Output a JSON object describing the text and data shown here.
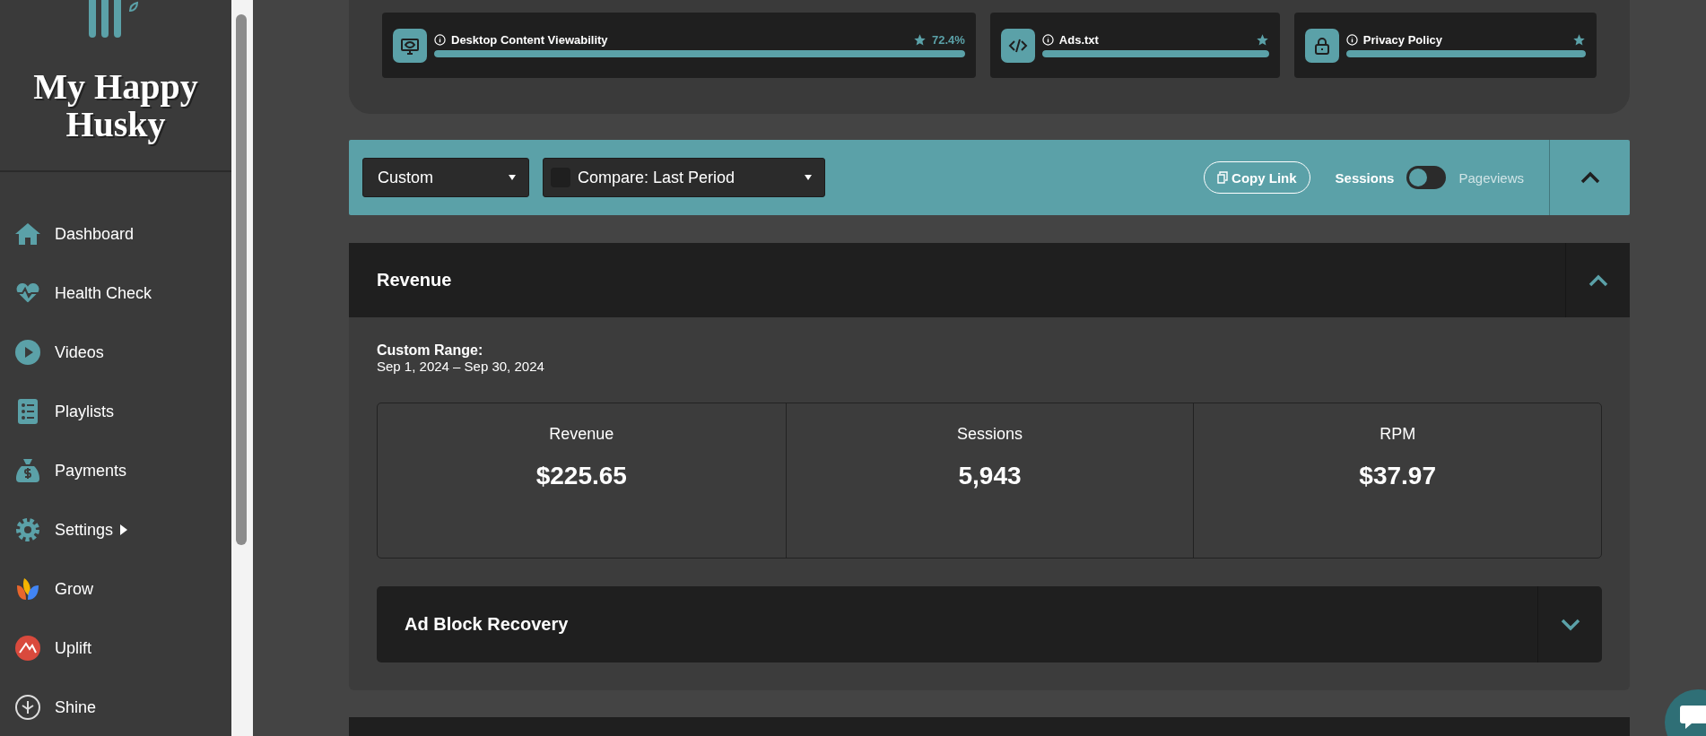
{
  "sidebar": {
    "brand": "My Happy Husky",
    "items": [
      {
        "label": "Dashboard",
        "submenu": false
      },
      {
        "label": "Health Check",
        "submenu": false
      },
      {
        "label": "Videos",
        "submenu": false
      },
      {
        "label": "Playlists",
        "submenu": false
      },
      {
        "label": "Payments",
        "submenu": false
      },
      {
        "label": "Settings",
        "submenu": true
      },
      {
        "label": "Grow",
        "submenu": false
      },
      {
        "label": "Uplift",
        "submenu": false
      },
      {
        "label": "Shine",
        "submenu": false
      }
    ]
  },
  "health_cards": [
    {
      "title": "Desktop Content Viewability",
      "starred": true,
      "reading": "72.4%",
      "level": 1
    },
    {
      "title": "Ads.txt",
      "starred": true,
      "level": 1
    },
    {
      "title": "Privacy Policy",
      "starred": true,
      "level": 1
    }
  ],
  "toolbar": {
    "range_select": {
      "value": "Custom"
    },
    "compare_select": {
      "checked": false,
      "value": "Compare: Last Period"
    },
    "copy_link": "Copy Link",
    "metric_toggle": {
      "left": "Sessions",
      "right": "Pageviews",
      "on": false
    },
    "expanded": true
  },
  "revenue_section": {
    "title": "Revenue",
    "expanded": true,
    "range_label": "Custom Range:",
    "range": "Sep 1, 2024 – Sep 30, 2024",
    "metrics": [
      {
        "label": "Revenue",
        "value": "$225.65"
      },
      {
        "label": "Sessions",
        "value": "5,943"
      },
      {
        "label": "RPM",
        "value": "$37.97"
      }
    ],
    "subsections": [
      {
        "title": "Ad Block Recovery",
        "expanded": false
      }
    ]
  }
}
